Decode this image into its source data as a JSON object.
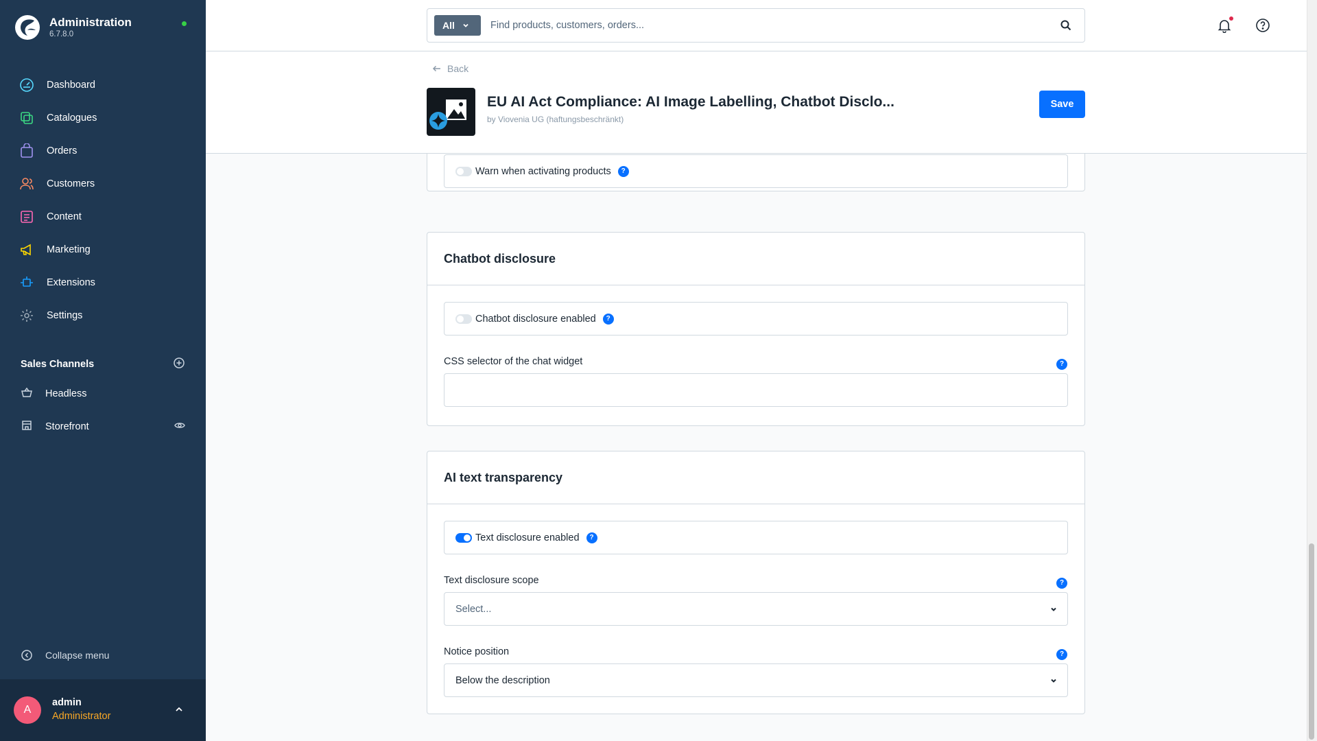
{
  "app": {
    "title": "Administration",
    "version": "6.7.8.0"
  },
  "nav": {
    "items": [
      {
        "label": "Dashboard",
        "icon": "dashboard-icon",
        "color": "#57d9ff"
      },
      {
        "label": "Catalogues",
        "icon": "catalogue-icon",
        "color": "#3bd983"
      },
      {
        "label": "Orders",
        "icon": "orders-icon",
        "color": "#a092f0"
      },
      {
        "label": "Customers",
        "icon": "customers-icon",
        "color": "#f88962"
      },
      {
        "label": "Content",
        "icon": "content-icon",
        "color": "#ff68b4"
      },
      {
        "label": "Marketing",
        "icon": "marketing-icon",
        "color": "#ffd700"
      },
      {
        "label": "Extensions",
        "icon": "extensions-icon",
        "color": "#189eff"
      },
      {
        "label": "Settings",
        "icon": "settings-icon",
        "color": "#9aa8b5"
      }
    ]
  },
  "sales_channels": {
    "title": "Sales Channels",
    "items": [
      {
        "label": "Headless",
        "icon": "basket-icon"
      },
      {
        "label": "Storefront",
        "icon": "storefront-icon"
      }
    ]
  },
  "collapse_label": "Collapse menu",
  "user": {
    "initial": "A",
    "name": "admin",
    "role": "Administrator"
  },
  "search": {
    "type_label": "All",
    "placeholder": "Find products, customers, orders..."
  },
  "smartbar": {
    "back_label": "Back",
    "title": "EU AI Act Compliance: AI Image Labelling, Chatbot Disclo...",
    "author": "by Viovenia UG (haftungsbeschränkt)",
    "save_label": "Save"
  },
  "sections": {
    "image": {
      "warn_toggle_label": "Warn when activating products",
      "warn_toggle_on": false
    },
    "chatbot": {
      "title": "Chatbot disclosure",
      "toggle_label": "Chatbot disclosure enabled",
      "toggle_on": false,
      "selector_label": "CSS selector of the chat widget",
      "selector_value": ""
    },
    "ai_text": {
      "title": "AI text transparency",
      "toggle_label": "Text disclosure enabled",
      "toggle_on": true,
      "scope_label": "Text disclosure scope",
      "scope_placeholder": "Select...",
      "position_label": "Notice position",
      "position_value": "Below the description"
    }
  },
  "help_glyph": "?",
  "colors": {
    "sidebar": "#1f3852",
    "primary": "#0870ff",
    "role": "#f9a826",
    "avatar": "#f35a78"
  }
}
